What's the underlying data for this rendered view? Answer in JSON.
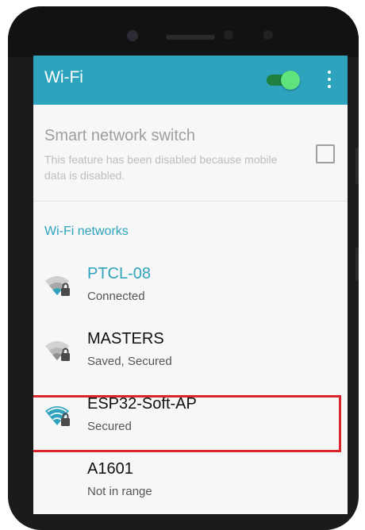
{
  "appbar": {
    "title": "Wi-Fi",
    "wifi_enabled": true,
    "accent_color": "#2ea3bd",
    "toggle_color": "#5fe37c"
  },
  "smart_switch": {
    "title": "Smart network switch",
    "description": "This feature has been disabled because mobile data is disabled.",
    "checked": false
  },
  "section_header": "Wi-Fi networks",
  "networks": [
    {
      "name": "PTCL-08",
      "status": "Connected",
      "icon": "wifi-lock-icon",
      "highlighted_name": true
    },
    {
      "name": "MASTERS",
      "status": "Saved, Secured",
      "icon": "wifi-lock-icon"
    },
    {
      "name": "ESP32-Soft-AP",
      "status": "Secured",
      "icon": "wifi-lock-icon",
      "outlined": true,
      "outline_color": "#d9252c"
    },
    {
      "name": "A1601",
      "status": "Not in range"
    }
  ]
}
